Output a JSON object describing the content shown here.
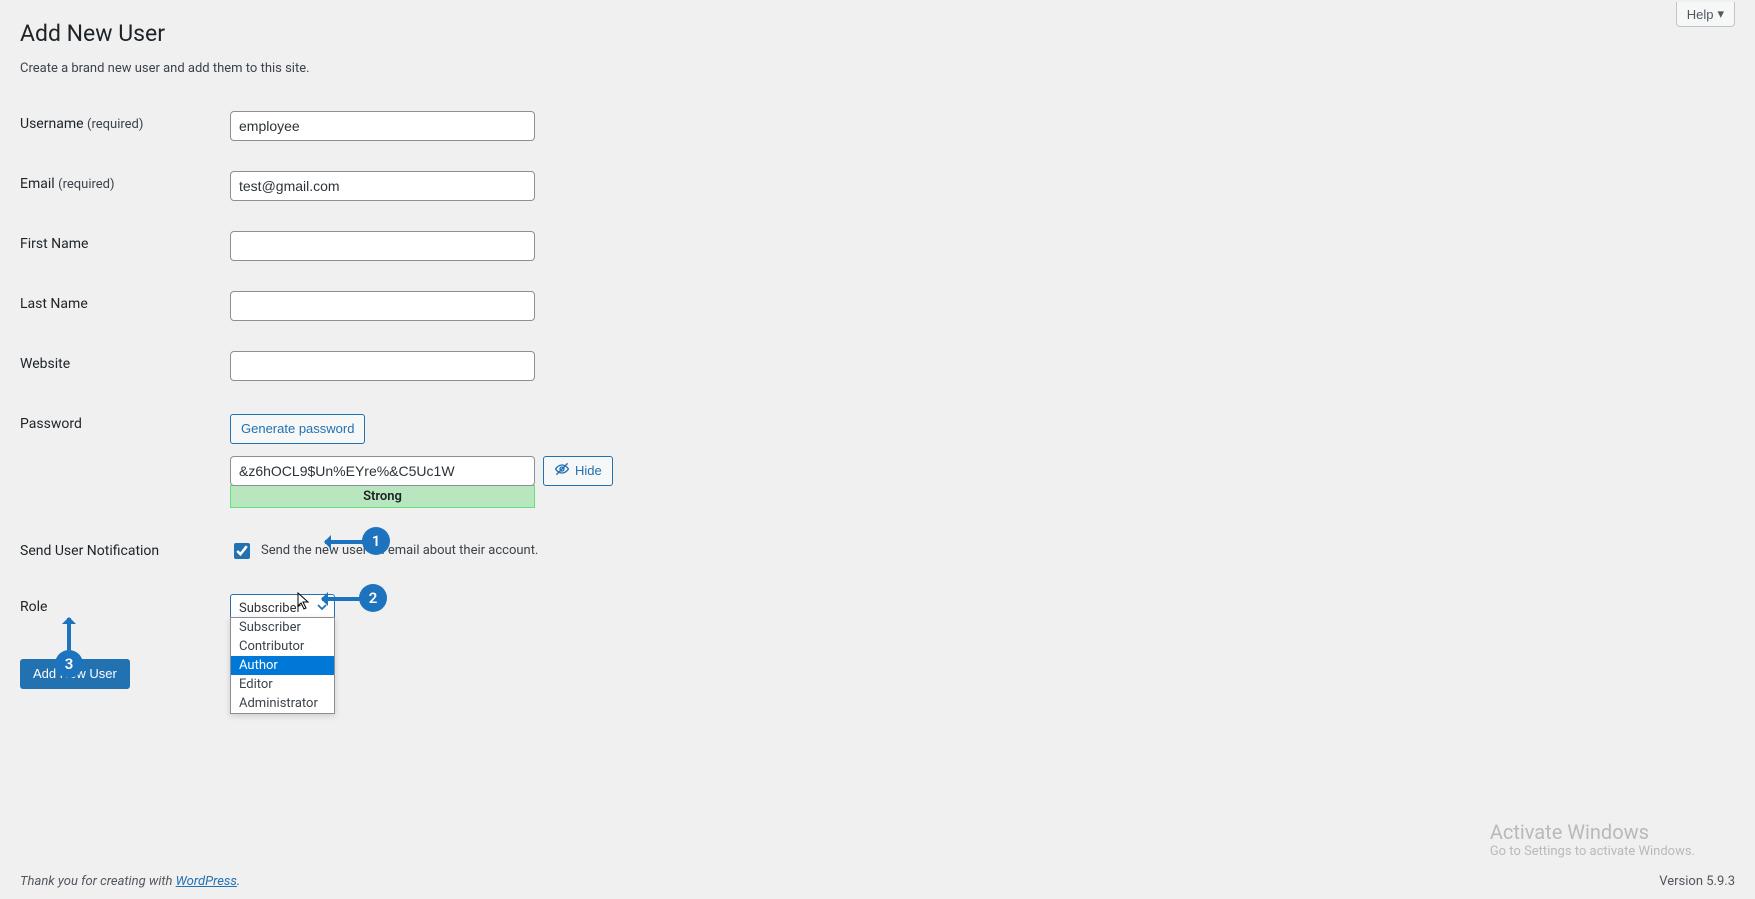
{
  "header": {
    "help": "Help",
    "title": "Add New User",
    "subtitle": "Create a brand new user and add them to this site."
  },
  "fields": {
    "username": {
      "label": "Username",
      "req": "(required)",
      "value": "employee"
    },
    "email": {
      "label": "Email",
      "req": "(required)",
      "value": "test@gmail.com"
    },
    "firstname": {
      "label": "First Name",
      "value": ""
    },
    "lastname": {
      "label": "Last Name",
      "value": ""
    },
    "website": {
      "label": "Website",
      "value": ""
    },
    "password": {
      "label": "Password",
      "generate": "Generate password",
      "value": "&z6hOCL9$Un%EYre%&C5Uc1W",
      "strength": "Strong",
      "hide": "Hide"
    },
    "notify": {
      "label": "Send User Notification",
      "text": "Send the new user an email about their account.",
      "checked": true
    },
    "role": {
      "label": "Role",
      "selected": "Subscriber",
      "options": [
        "Subscriber",
        "Contributor",
        "Author",
        "Editor",
        "Administrator"
      ],
      "highlighted": "Author"
    }
  },
  "submit": {
    "label": "Add New User"
  },
  "annotations": {
    "b1": "1",
    "b2": "2",
    "b3": "3"
  },
  "footer": {
    "thanks_pre": "Thank you for creating with ",
    "thanks_link": "WordPress",
    "thanks_post": ".",
    "version": "Version 5.9.3"
  },
  "watermark": {
    "line1": "Activate Windows",
    "line2": "Go to Settings to activate Windows."
  }
}
